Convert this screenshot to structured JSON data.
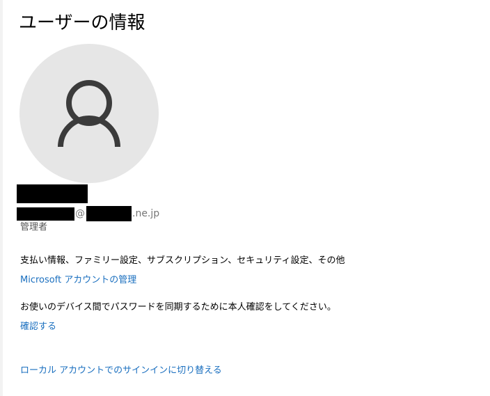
{
  "page_title": "ユーザーの情報",
  "avatar_icon": "user-silhouette-icon",
  "account": {
    "email_at": "@",
    "email_suffix": ".ne.jp",
    "role": "管理者"
  },
  "microsoft_account": {
    "description": "支払い情報、ファミリー設定、サブスクリプション、セキュリティ設定、その他",
    "manage_link": "Microsoft アカウントの管理"
  },
  "password_sync": {
    "description": "お使いのデバイス間でパスワードを同期するために本人確認をしてください。",
    "verify_link": "確認する"
  },
  "switch_link": "ローカル アカウントでのサインインに切り替える",
  "colors": {
    "link": "#1a6fbf",
    "avatar_bg": "#e6e6e6",
    "avatar_glyph": "#3b3b3b",
    "secondary_text": "#767676"
  }
}
